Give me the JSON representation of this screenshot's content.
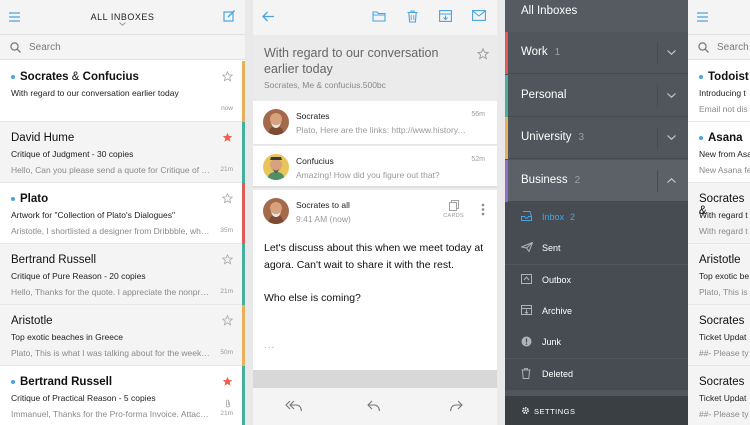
{
  "inbox": {
    "title": "ALL INBOXES",
    "search_placeholder": "Search",
    "emails": [
      {
        "from_a": "Socrates",
        "joiner": " & ",
        "from_b": "Confucius",
        "subject": "With regard to our conversation earlier today",
        "preview": "",
        "time": "now",
        "unread": true,
        "starred": false,
        "clip": false,
        "color": "#e6b15a"
      },
      {
        "from_a": "David Hume",
        "joiner": "",
        "from_b": "",
        "subject": "Critique of Judgment - 30 copies",
        "preview": "Hello, Can you please send a quote for Critique of Judgment",
        "time": "21m",
        "unread": false,
        "starred": true,
        "clip": false,
        "color": "#46b0a0"
      },
      {
        "from_a": "Plato",
        "joiner": "",
        "from_b": "",
        "subject": "Artwork for \"Collection of Plato's Dialogues\"",
        "preview": "Aristotle, I shortlisted a designer from Dribbble, what do you think",
        "time": "35m",
        "unread": true,
        "starred": false,
        "clip": false,
        "color": "#e05a5a"
      },
      {
        "from_a": "Bertrand Russell",
        "joiner": "",
        "from_b": "",
        "subject": "Critique of Pure Reason - 20 copies",
        "preview": "Hello, Thanks for the quote. I appreciate the nonprofit discount",
        "time": "21m",
        "unread": false,
        "starred": false,
        "clip": false,
        "color": "#46b0a0"
      },
      {
        "from_a": "Aristotle",
        "joiner": "",
        "from_b": "",
        "subject": "Top exotic beaches in Greece",
        "preview": "Plato, This is what I was talking about for the weekend",
        "time": "50m",
        "unread": false,
        "starred": false,
        "clip": false,
        "color": "#e6b15a"
      },
      {
        "from_a": "Bertrand Russell",
        "joiner": "",
        "from_b": "",
        "subject": "Critique of Practical Reason - 5 copies",
        "preview": "Immanuel, Thanks for the Pro-forma Invoice. Attached is the",
        "time": "21m",
        "unread": true,
        "starred": true,
        "clip": true,
        "color": "#46b0a0"
      }
    ]
  },
  "message": {
    "subject": "With regard to our conversation earlier today",
    "participants": "Socrates, Me & confucius.500bc",
    "thread": [
      {
        "name": "Socrates",
        "preview": "Plato, Here are the links: http://www.history.com",
        "time": "56m"
      },
      {
        "name": "Confucius",
        "preview": "Amazing! How did you figure out that?",
        "time": "52m"
      },
      {
        "name": "Socrates to all",
        "preview": "9:41 AM (now)",
        "time": ""
      }
    ],
    "cards_label": "CARDS",
    "body_p1": "Let's discuss about this when we meet today at agora. Can't wait to share it with the rest.",
    "body_p2": "Who else is coming?",
    "body_more": "..."
  },
  "sidebar": {
    "header": "All Inboxes",
    "accounts": [
      {
        "name": "Work",
        "count": "1",
        "color": "#e05a5a",
        "open": false
      },
      {
        "name": "Personal",
        "count": "",
        "color": "#46b0a0",
        "open": false
      },
      {
        "name": "University",
        "count": "3",
        "color": "#e6b15a",
        "open": false
      },
      {
        "name": "Business",
        "count": "2",
        "color": "#8f6fc8",
        "open": true
      }
    ],
    "folders": [
      {
        "label": "Inbox",
        "count": "2",
        "icon": "inbox-icon",
        "active": true
      },
      {
        "label": "Sent",
        "count": "",
        "icon": "sent-icon",
        "active": false
      },
      {
        "label": "Outbox",
        "count": "",
        "icon": "outbox-icon",
        "active": false
      },
      {
        "label": "Archive",
        "count": "",
        "icon": "archive-icon",
        "active": false
      },
      {
        "label": "Junk",
        "count": "",
        "icon": "junk-icon",
        "active": false
      },
      {
        "label": "Deleted",
        "count": "",
        "icon": "deleted-icon",
        "active": false
      }
    ],
    "settings_label": "SETTINGS"
  },
  "inbox2": {
    "search_placeholder": "Search",
    "emails": [
      {
        "from": "Todoist",
        "subject": "Introducing t",
        "preview": "Email not dis",
        "unread": true,
        "color": "#e05a5a"
      },
      {
        "from": "Asana",
        "subject": "New from Asa",
        "preview": "New Asana fe",
        "unread": true,
        "color": "#46b0a0"
      },
      {
        "from": "Socrates &",
        "subject": "With regard t",
        "preview": "With regard t",
        "unread": false,
        "color": "#e6b15a"
      },
      {
        "from": "Aristotle",
        "subject": "Top exotic be",
        "preview": "Plato, This is",
        "unread": false,
        "color": "#46b0a0"
      },
      {
        "from": "Socrates",
        "subject": "Ticket Updat",
        "preview": "##- Please ty",
        "unread": false,
        "color": "#e6b15a"
      },
      {
        "from": "Socrates",
        "subject": "Ticket Updat",
        "preview": "##- Please ty",
        "unread": false,
        "color": "#46b0a0"
      }
    ]
  },
  "colors": {
    "accent": "#4aa3df",
    "star": "#f0624d"
  }
}
